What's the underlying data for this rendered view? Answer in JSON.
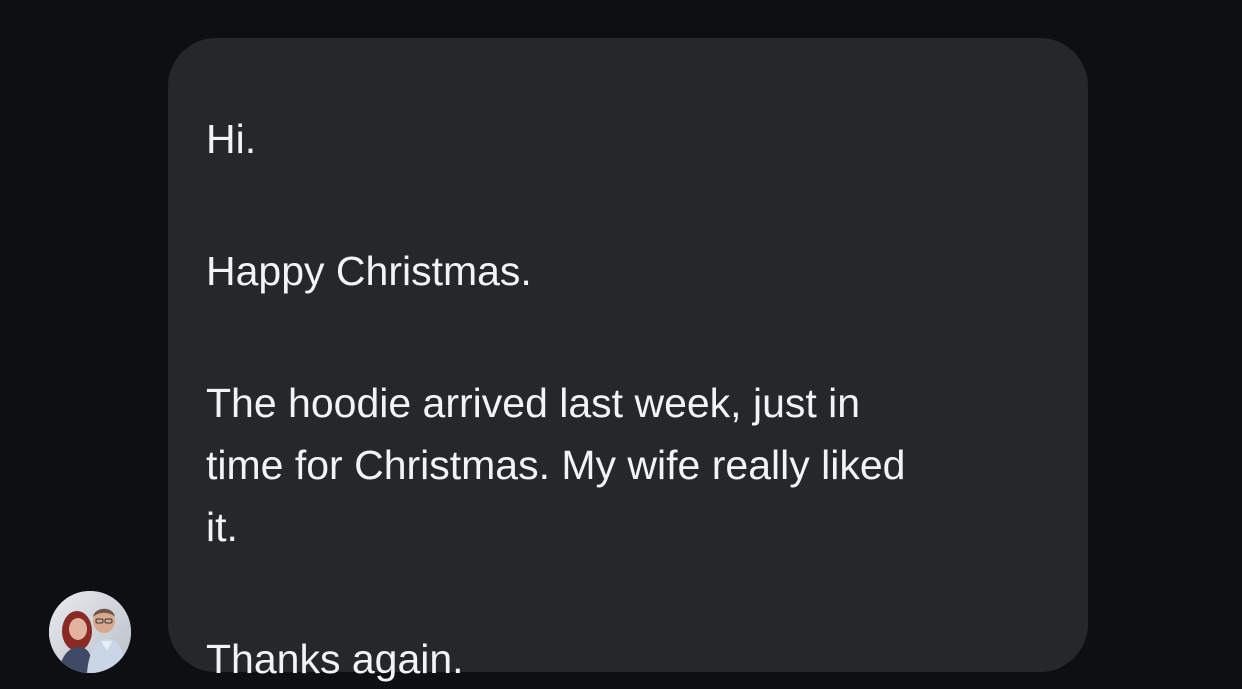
{
  "conversation": {
    "message": {
      "line1": "Hi.",
      "line2": "Happy Christmas.",
      "line3a": "The hoodie arrived last week, just in",
      "line3b": "time for Christmas. My wife really liked",
      "line3c": "it.",
      "line4": "Thanks again."
    },
    "sender_avatar": {
      "icon": "profile-photo-icon"
    },
    "colors": {
      "background": "#0d0f12",
      "bubble": "#25272b",
      "text": "#f2f3f5"
    }
  }
}
